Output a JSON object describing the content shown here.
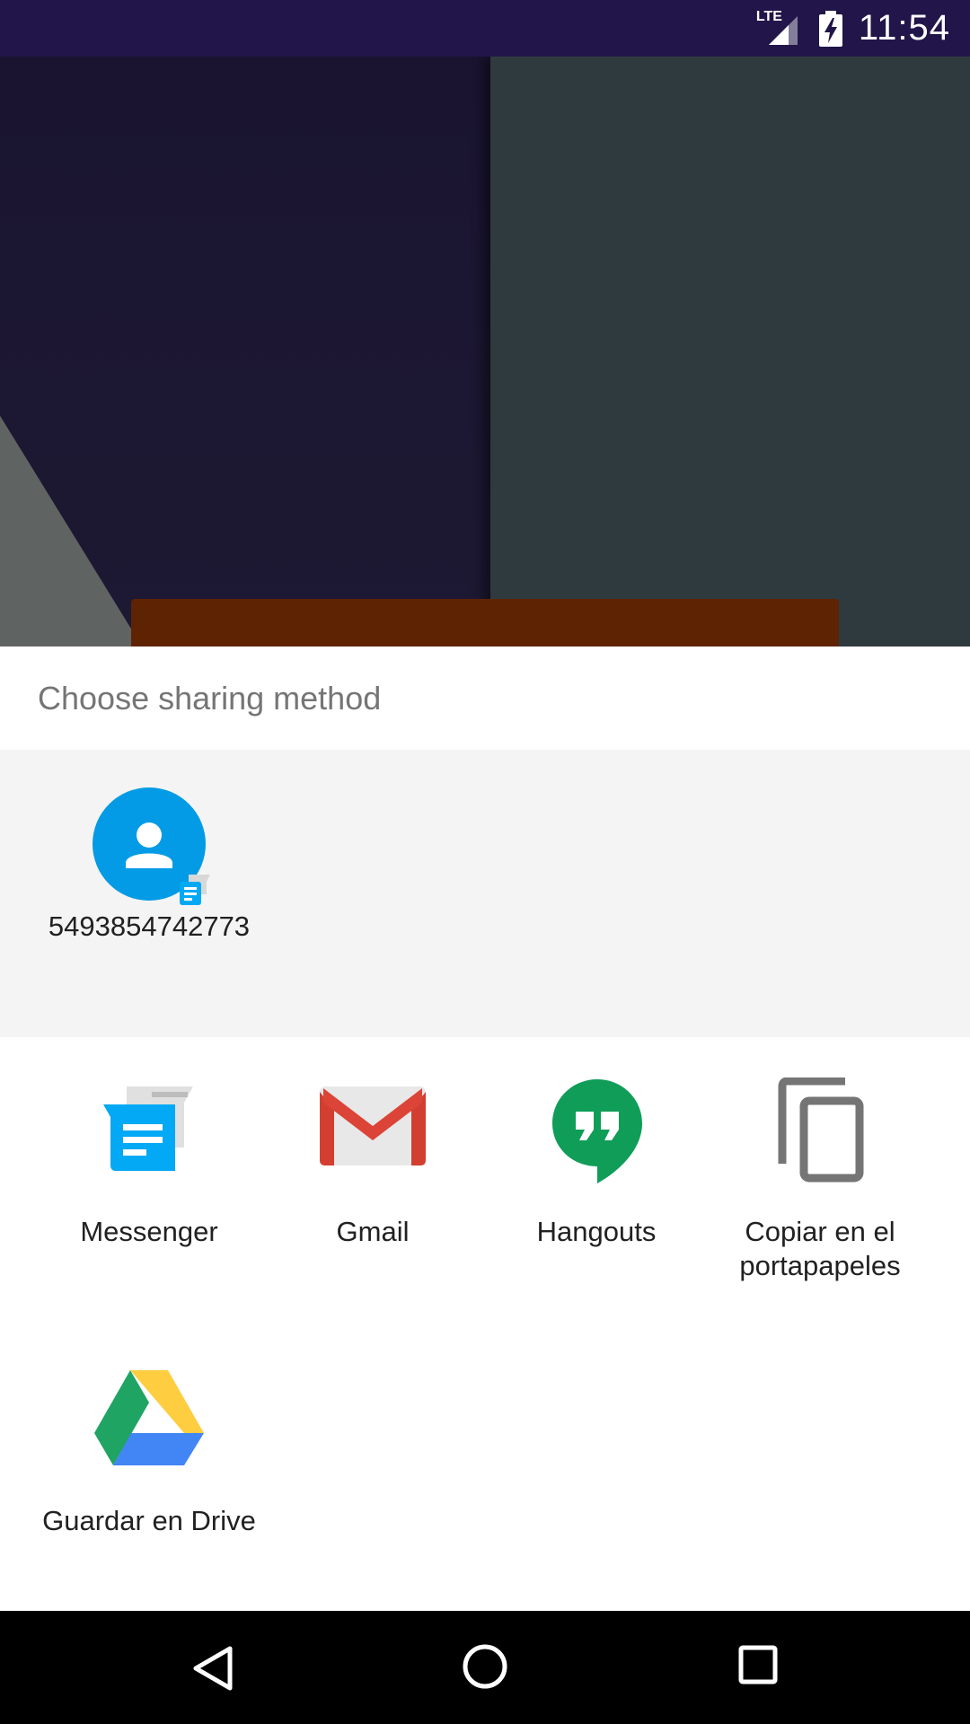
{
  "status_bar": {
    "network": "LTE",
    "time": "11:54"
  },
  "share_sheet": {
    "title": "Choose sharing method",
    "direct_share": [
      {
        "label": "5493854742773",
        "icon": "contact-avatar-icon",
        "badge_icon": "messenger-badge-icon"
      }
    ],
    "targets": [
      {
        "label": "Messenger",
        "icon": "messenger-icon"
      },
      {
        "label": "Gmail",
        "icon": "gmail-icon"
      },
      {
        "label": "Hangouts",
        "icon": "hangouts-icon"
      },
      {
        "label_line1": "Copiar en el",
        "label_line2": "portapapeles",
        "icon": "copy-icon"
      },
      {
        "label": "Guardar en Drive",
        "icon": "drive-icon"
      }
    ]
  },
  "nav_bar": {
    "buttons": [
      "back",
      "home",
      "recents"
    ]
  },
  "colors": {
    "status_bar": "#21154a",
    "contact_avatar": "#039be5",
    "messenger": "#03a9f4",
    "gmail_red": "#db4437",
    "hangouts": "#0f9d58",
    "title_text": "#757575",
    "label_text": "#212121"
  }
}
